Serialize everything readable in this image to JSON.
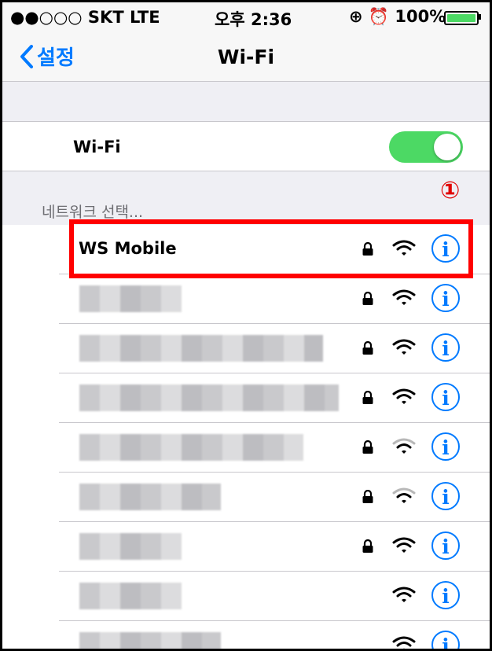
{
  "status_bar": {
    "carrier": "●●○○○ SKT  LTE",
    "time": "오후 2:36",
    "right": "⊕ ⏰ 100%",
    "battery_level": 1.0
  },
  "nav": {
    "back_label": "설정",
    "title": "Wi-Fi"
  },
  "wifi_toggle": {
    "label": "Wi-Fi",
    "on": true
  },
  "section": {
    "label": "네트워크 선택..."
  },
  "annotation": {
    "marker": "①",
    "color": "#ff0000"
  },
  "networks": [
    {
      "name": "WS Mobile",
      "blurred": false,
      "locked": true,
      "signal": "full"
    },
    {
      "name": "",
      "blurred": true,
      "locked": true,
      "signal": "full"
    },
    {
      "name": "",
      "blurred": true,
      "locked": true,
      "signal": "full"
    },
    {
      "name": "",
      "blurred": true,
      "locked": true,
      "signal": "full"
    },
    {
      "name": "",
      "blurred": true,
      "locked": true,
      "signal": "weak"
    },
    {
      "name": "",
      "blurred": true,
      "locked": true,
      "signal": "weak"
    },
    {
      "name": "",
      "blurred": true,
      "locked": true,
      "signal": "full"
    },
    {
      "name": "",
      "blurred": true,
      "locked": false,
      "signal": "full"
    },
    {
      "name": "",
      "blurred": true,
      "locked": false,
      "signal": "full"
    }
  ],
  "colors": {
    "accent": "#007aff",
    "toggle_on": "#4cd964",
    "highlight": "#ff0000"
  },
  "icons": {
    "back": "chevron-left-icon",
    "lock": "lock-icon",
    "wifi": "wifi-icon",
    "info": "info-icon"
  }
}
